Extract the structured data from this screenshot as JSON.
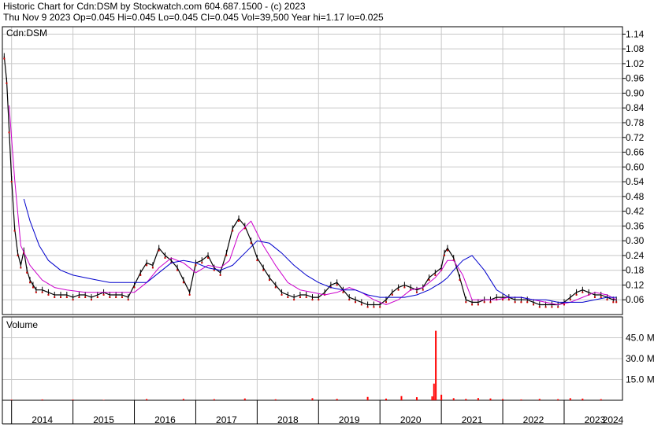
{
  "header": {
    "line1": "Historic Chart for Cdn:DSM by Stockwatch.com 604.687.1500 - (c) 2023",
    "line2": "Thu Nov  9 2023  Op=0.045  Hi=0.045  Lo=0.045  Cl=0.045  Vol=39,500  Year hi=1.17  lo=0.025"
  },
  "chart_data": {
    "type": "line",
    "price_panel": {
      "label": "Cdn:DSM",
      "yticks": [
        "1.14",
        "1.08",
        "1.02",
        "0.96",
        "0.90",
        "0.84",
        "0.78",
        "0.72",
        "0.66",
        "0.60",
        "0.54",
        "0.48",
        "0.42",
        "0.36",
        "0.30",
        "0.24",
        "0.18",
        "0.12",
        "0.06"
      ],
      "ylim": [
        0.0,
        1.17
      ]
    },
    "volume_panel": {
      "label": "Volume",
      "yticks": [
        "45.0 M",
        "30.0 M",
        "15.0 M"
      ],
      "ylim": [
        0,
        60
      ]
    },
    "x_labels": [
      "2014",
      "2015",
      "2016",
      "2017",
      "2018",
      "2019",
      "2020",
      "2021",
      "2022",
      "2023",
      "2024"
    ],
    "xlim": [
      2013.85,
      2023.95
    ],
    "series": [
      {
        "kind": "price",
        "color": "#000000",
        "x": [
          2013.88,
          2013.92,
          2013.96,
          2014.0,
          2014.05,
          2014.1,
          2014.15,
          2014.2,
          2014.25,
          2014.3,
          2014.35,
          2014.4,
          2014.5,
          2014.6,
          2014.7,
          2014.8,
          2014.9,
          2015.0,
          2015.1,
          2015.2,
          2015.3,
          2015.4,
          2015.5,
          2015.6,
          2015.7,
          2015.8,
          2015.9,
          2016.0,
          2016.1,
          2016.2,
          2016.3,
          2016.4,
          2016.5,
          2016.6,
          2016.7,
          2016.8,
          2016.9,
          2017.0,
          2017.1,
          2017.2,
          2017.3,
          2017.4,
          2017.5,
          2017.6,
          2017.7,
          2017.8,
          2017.9,
          2018.0,
          2018.1,
          2018.2,
          2018.3,
          2018.4,
          2018.5,
          2018.6,
          2018.7,
          2018.8,
          2018.9,
          2019.0,
          2019.1,
          2019.2,
          2019.3,
          2019.4,
          2019.5,
          2019.6,
          2019.7,
          2019.8,
          2019.9,
          2020.0,
          2020.1,
          2020.2,
          2020.3,
          2020.4,
          2020.5,
          2020.6,
          2020.7,
          2020.8,
          2020.9,
          2021.0,
          2021.05,
          2021.1,
          2021.2,
          2021.3,
          2021.4,
          2021.5,
          2021.6,
          2021.7,
          2021.8,
          2021.9,
          2022.0,
          2022.1,
          2022.2,
          2022.3,
          2022.4,
          2022.5,
          2022.6,
          2022.7,
          2022.8,
          2022.9,
          2023.0,
          2023.1,
          2023.2,
          2023.3,
          2023.4,
          2023.5,
          2023.6,
          2023.7,
          2023.8,
          2023.85
        ],
        "values": [
          1.05,
          0.95,
          0.75,
          0.55,
          0.35,
          0.25,
          0.2,
          0.26,
          0.18,
          0.14,
          0.12,
          0.1,
          0.1,
          0.09,
          0.08,
          0.08,
          0.08,
          0.07,
          0.08,
          0.08,
          0.07,
          0.08,
          0.09,
          0.08,
          0.08,
          0.08,
          0.07,
          0.12,
          0.17,
          0.21,
          0.2,
          0.27,
          0.24,
          0.22,
          0.19,
          0.14,
          0.09,
          0.21,
          0.22,
          0.24,
          0.19,
          0.17,
          0.25,
          0.35,
          0.39,
          0.36,
          0.3,
          0.23,
          0.19,
          0.15,
          0.12,
          0.09,
          0.08,
          0.07,
          0.08,
          0.08,
          0.07,
          0.07,
          0.09,
          0.12,
          0.13,
          0.1,
          0.07,
          0.06,
          0.05,
          0.04,
          0.04,
          0.04,
          0.06,
          0.09,
          0.11,
          0.12,
          0.11,
          0.1,
          0.11,
          0.15,
          0.17,
          0.19,
          0.25,
          0.27,
          0.23,
          0.15,
          0.06,
          0.05,
          0.05,
          0.06,
          0.06,
          0.07,
          0.07,
          0.07,
          0.06,
          0.06,
          0.06,
          0.05,
          0.04,
          0.04,
          0.04,
          0.04,
          0.05,
          0.07,
          0.09,
          0.1,
          0.09,
          0.08,
          0.08,
          0.07,
          0.06,
          0.06
        ]
      },
      {
        "kind": "ma-short",
        "color": "#cc00cc",
        "x": [
          2013.96,
          2014.05,
          2014.15,
          2014.3,
          2014.5,
          2014.7,
          2014.9,
          2015.2,
          2015.5,
          2015.8,
          2016.0,
          2016.2,
          2016.4,
          2016.6,
          2016.8,
          2017.0,
          2017.2,
          2017.4,
          2017.55,
          2017.7,
          2017.9,
          2018.1,
          2018.3,
          2018.5,
          2018.7,
          2018.9,
          2019.1,
          2019.3,
          2019.5,
          2019.7,
          2019.9,
          2020.1,
          2020.3,
          2020.5,
          2020.7,
          2020.9,
          2021.0,
          2021.1,
          2021.2,
          2021.35,
          2021.5,
          2021.7,
          2021.9,
          2022.1,
          2022.3,
          2022.5,
          2022.7,
          2022.9,
          2023.1,
          2023.3,
          2023.5,
          2023.7,
          2023.85
        ],
        "values": [
          0.85,
          0.55,
          0.28,
          0.2,
          0.14,
          0.11,
          0.1,
          0.09,
          0.09,
          0.09,
          0.09,
          0.13,
          0.19,
          0.23,
          0.21,
          0.17,
          0.2,
          0.19,
          0.22,
          0.33,
          0.38,
          0.28,
          0.2,
          0.13,
          0.1,
          0.09,
          0.08,
          0.09,
          0.11,
          0.09,
          0.06,
          0.04,
          0.06,
          0.1,
          0.11,
          0.15,
          0.18,
          0.22,
          0.22,
          0.16,
          0.06,
          0.06,
          0.06,
          0.07,
          0.07,
          0.06,
          0.05,
          0.04,
          0.05,
          0.07,
          0.09,
          0.08,
          0.06
        ]
      },
      {
        "kind": "ma-long",
        "color": "#0000cc",
        "x": [
          2014.2,
          2014.3,
          2014.45,
          2014.6,
          2014.8,
          2015.0,
          2015.2,
          2015.4,
          2015.6,
          2015.8,
          2016.0,
          2016.2,
          2016.4,
          2016.6,
          2016.8,
          2017.0,
          2017.2,
          2017.4,
          2017.6,
          2017.8,
          2018.0,
          2018.2,
          2018.4,
          2018.6,
          2018.8,
          2019.0,
          2019.2,
          2019.4,
          2019.6,
          2019.8,
          2020.0,
          2020.2,
          2020.4,
          2020.6,
          2020.8,
          2021.0,
          2021.1,
          2021.2,
          2021.35,
          2021.5,
          2021.7,
          2021.9,
          2022.1,
          2022.3,
          2022.5,
          2022.7,
          2022.9,
          2023.1,
          2023.3,
          2023.5,
          2023.7,
          2023.85
        ],
        "values": [
          0.47,
          0.38,
          0.28,
          0.22,
          0.18,
          0.16,
          0.15,
          0.14,
          0.13,
          0.13,
          0.13,
          0.13,
          0.17,
          0.21,
          0.22,
          0.21,
          0.19,
          0.18,
          0.2,
          0.25,
          0.3,
          0.29,
          0.25,
          0.2,
          0.16,
          0.13,
          0.11,
          0.1,
          0.1,
          0.08,
          0.07,
          0.07,
          0.07,
          0.08,
          0.1,
          0.13,
          0.15,
          0.18,
          0.22,
          0.24,
          0.18,
          0.1,
          0.07,
          0.07,
          0.06,
          0.06,
          0.05,
          0.05,
          0.05,
          0.06,
          0.07,
          0.07
        ]
      },
      {
        "kind": "volume",
        "color": "#ff0000",
        "x": [
          2014.0,
          2014.5,
          2015.0,
          2015.5,
          2016.2,
          2016.8,
          2017.3,
          2017.8,
          2018.3,
          2018.9,
          2019.3,
          2019.8,
          2020.1,
          2020.35,
          2020.6,
          2020.85,
          2020.88,
          2020.91,
          2021.0,
          2021.2,
          2021.4,
          2021.6,
          2021.8,
          2022.0,
          2022.3,
          2022.6,
          2022.9,
          2023.1,
          2023.3,
          2023.6
        ],
        "values": [
          0.4,
          0.6,
          0.5,
          0.3,
          0.9,
          1.0,
          0.8,
          1.3,
          0.7,
          1.5,
          1.0,
          2.4,
          1.2,
          3.0,
          2.2,
          2.8,
          12.0,
          50.0,
          4.0,
          1.5,
          1.0,
          1.6,
          1.3,
          0.9,
          0.6,
          1.0,
          0.8,
          1.5,
          1.2,
          0.8
        ]
      }
    ],
    "grid": true
  }
}
